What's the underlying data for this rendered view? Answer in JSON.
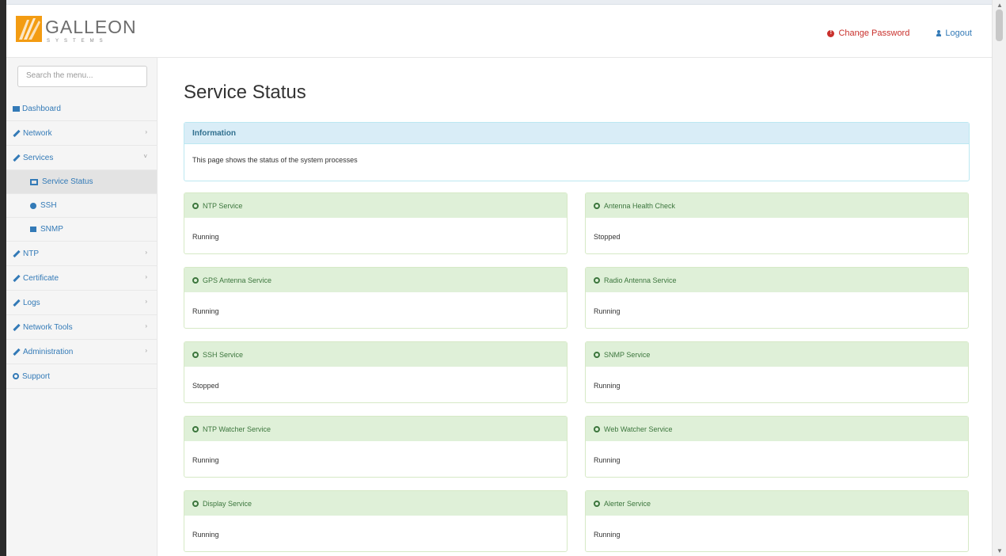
{
  "header": {
    "logo_text": "GALLEON",
    "logo_subtext": "SYSTEMS",
    "change_password_label": "Change Password",
    "logout_label": "Logout"
  },
  "sidebar": {
    "search_placeholder": "Search the menu...",
    "items": [
      {
        "label": "Dashboard",
        "icon": "dashboard-icon"
      },
      {
        "label": "Network",
        "icon": "wrench-icon",
        "expand": "›"
      },
      {
        "label": "Services",
        "icon": "wrench-icon",
        "expand": "˅"
      },
      {
        "label": "Service Status",
        "icon": "table-icon"
      },
      {
        "label": "SSH",
        "icon": "globe-icon"
      },
      {
        "label": "SNMP",
        "icon": "lock-icon"
      },
      {
        "label": "NTP",
        "icon": "wrench-icon",
        "expand": "›"
      },
      {
        "label": "Certificate",
        "icon": "wrench-icon",
        "expand": "›"
      },
      {
        "label": "Logs",
        "icon": "wrench-icon",
        "expand": "›"
      },
      {
        "label": "Network Tools",
        "icon": "wrench-icon",
        "expand": "›"
      },
      {
        "label": "Administration",
        "icon": "wrench-icon",
        "expand": "›"
      },
      {
        "label": "Support",
        "icon": "circle-icon"
      }
    ]
  },
  "main": {
    "title": "Service Status",
    "info": {
      "heading": "Information",
      "text": "This page shows the status of the system processes"
    },
    "services": [
      {
        "name": "NTP Service",
        "status": "Running"
      },
      {
        "name": "Antenna Health Check",
        "status": "Stopped"
      },
      {
        "name": "GPS Antenna Service",
        "status": "Running"
      },
      {
        "name": "Radio Antenna Service",
        "status": "Running"
      },
      {
        "name": "SSH Service",
        "status": "Stopped"
      },
      {
        "name": "SNMP Service",
        "status": "Running"
      },
      {
        "name": "NTP Watcher Service",
        "status": "Running"
      },
      {
        "name": "Web Watcher Service",
        "status": "Running"
      },
      {
        "name": "Display Service",
        "status": "Running"
      },
      {
        "name": "Alerter Service",
        "status": "Running"
      }
    ]
  },
  "colors": {
    "logo_orange": "#f39c12",
    "link_blue": "#337ab7",
    "danger_red": "#c9302c",
    "info_bg": "#d9edf7",
    "service_bg": "#dff0d8"
  }
}
